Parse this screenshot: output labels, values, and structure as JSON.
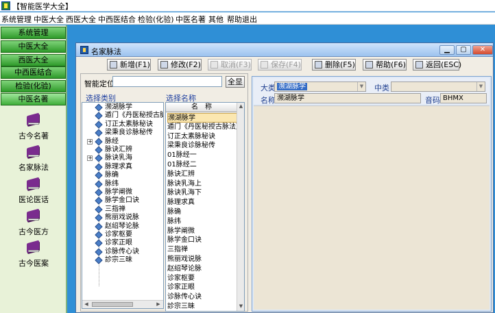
{
  "app": {
    "title": "【智能医学大全】"
  },
  "menu": [
    "系统管理",
    "中医大全",
    "西医大全",
    "中西医结合",
    "检验(化验)",
    "中医名著",
    "其他",
    "帮助退出"
  ],
  "sidebar": {
    "buttons": [
      "系统管理",
      "中医大全",
      "西医大全",
      "中西医结合",
      "检验(化验)",
      "中医名著"
    ],
    "books": [
      "古今名著",
      "名家脉法",
      "医论医话",
      "古今医方",
      "古今医案"
    ]
  },
  "window": {
    "title": "名家脉法",
    "controls": [
      "▁",
      "▢",
      "✕"
    ]
  },
  "toolbar": {
    "add": "新增(F1)",
    "edit": "修改(F2)",
    "cancel": "取消(F3)",
    "save": "保存(F4)",
    "delete": "删除(F5)",
    "help": "帮助(F6)",
    "back": "返回(ESC)"
  },
  "search": {
    "label": "智能定位",
    "value": "",
    "all_button": "全显"
  },
  "category": {
    "header": "选择类别",
    "items": [
      "濒湖脉学",
      "遁门《丹医秘授古脉",
      "订正太素脉秘诀",
      "梁秉良诊脉秘传",
      "脉经",
      "脉诀汇辨",
      "脉诀乳海",
      "脉理求真",
      "脉确",
      "脉纬",
      "脉学阐微",
      "脉学金口诀",
      "三指禅",
      "熊丽戏说脉",
      "赵绍琴论脉",
      "诊家枢要",
      "诊家正眼",
      "诊脉传心诀",
      "診宗三昧"
    ],
    "expandable": {
      "4": "+",
      "6": "+"
    }
  },
  "namelist": {
    "header": "选择名称",
    "column": "名　称",
    "items": [
      "濒湖脉学",
      "遁门《丹医秘授古脉法》",
      "订正太素脉秘诀",
      "梁秉良诊脉秘传",
      "01脉经一",
      "01脉经二",
      "脉诀汇辨",
      "脉诀乳海上",
      "脉诀乳海下",
      "脉理求真",
      "脉确",
      "脉纬",
      "脉学阐微",
      "脉学金口诀",
      "三指禅",
      "熊丽戏说脉",
      "赵绍琴论脉",
      "诊家枢要",
      "诊家正眼",
      "诊脉传心诀",
      "診宗三昧"
    ],
    "selected_index": 0
  },
  "detail": {
    "dalei_label": "大类",
    "dalei_value": "濒湖脉学",
    "zhonglei_label": "中类",
    "zhonglei_value": "",
    "mingcheng_label": "名称",
    "mingcheng_value": "濒湖脉学",
    "yinma_label": "音码",
    "yinma_value": "BHMX"
  },
  "colors": {
    "desktop": "#2f8fd6",
    "nav_green": "#2e9a2a",
    "selection": "#316ac5"
  }
}
